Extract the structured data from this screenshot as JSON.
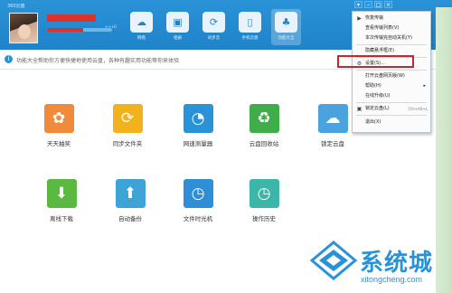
{
  "app": {
    "title": "360云盘",
    "capacity_text": "+++G",
    "capacity_fraction": 0.55,
    "window_controls": [
      "▾",
      "–",
      "□",
      "×"
    ]
  },
  "top_nav": [
    {
      "label": "网盘",
      "icon": "cloud-icon",
      "glyph": "☁"
    },
    {
      "label": "相册",
      "icon": "photo-icon",
      "glyph": "▣"
    },
    {
      "label": "同步云",
      "icon": "sync-icon",
      "glyph": "⟳"
    },
    {
      "label": "手机云盘",
      "icon": "phone-icon",
      "glyph": "▯"
    },
    {
      "label": "功能大全",
      "icon": "apps-icon",
      "glyph": "♣"
    }
  ],
  "notice": {
    "text": "功能大全帮助你方便快捷地使用云盘，各种有趣实用功能等你来体验"
  },
  "tools": [
    {
      "label": "天天抽奖",
      "icon": "lottery-icon",
      "glyph": "✿",
      "color": "#f08b3b"
    },
    {
      "label": "同步文件夹",
      "icon": "sync-folder-icon",
      "glyph": "⟳",
      "color": "#f2b21c"
    },
    {
      "label": "网速测量器",
      "icon": "speedometer-icon",
      "glyph": "◔",
      "color": "#2a93d8"
    },
    {
      "label": "云盘回收站",
      "icon": "recycle-icon",
      "glyph": "♻",
      "color": "#3fae4a"
    },
    {
      "label": "锁定云盘",
      "icon": "cloud-lock-icon",
      "glyph": "☁",
      "color": "#4aa3df"
    },
    {
      "label": "离线下载",
      "icon": "offline-download-icon",
      "glyph": "⬇",
      "color": "#5bb840"
    },
    {
      "label": "自动备份",
      "icon": "auto-backup-icon",
      "glyph": "⬆",
      "color": "#3ea3d6"
    },
    {
      "label": "文件时光机",
      "icon": "time-machine-icon",
      "glyph": "◷",
      "color": "#2e8fd6"
    },
    {
      "label": "操作历史",
      "icon": "history-icon",
      "glyph": "◷",
      "color": "#3cb6a8"
    }
  ],
  "menu": {
    "items": [
      {
        "label": "恢复传输",
        "icon": "resume-icon",
        "glyph": "▶"
      },
      {
        "label": "查看传输列表(V)",
        "icon": "",
        "glyph": ""
      },
      {
        "label": "本次传输完自动关机(Y)",
        "icon": "",
        "glyph": ""
      },
      {
        "label": "隐藏悬浮框(E)",
        "icon": "",
        "glyph": ""
      },
      {
        "label": "设置(S)...",
        "icon": "settings-icon",
        "glyph": "⚙"
      },
      {
        "label": "打开云盘网页版(W)",
        "icon": "",
        "glyph": ""
      },
      {
        "label": "帮助(H)",
        "icon": "",
        "glyph": "",
        "submenu": true
      },
      {
        "label": "在线升级(U)",
        "icon": "",
        "glyph": ""
      },
      {
        "label": "锁定云盘(L)",
        "icon": "lock-icon",
        "glyph": "🔒",
        "shortcut": "Ctrl+Alt+L"
      },
      {
        "label": "退出(X)",
        "icon": "",
        "glyph": ""
      }
    ],
    "submenu_arrow": "▸"
  },
  "watermark": {
    "title": "系统城",
    "url": "xitongcheng.com"
  }
}
